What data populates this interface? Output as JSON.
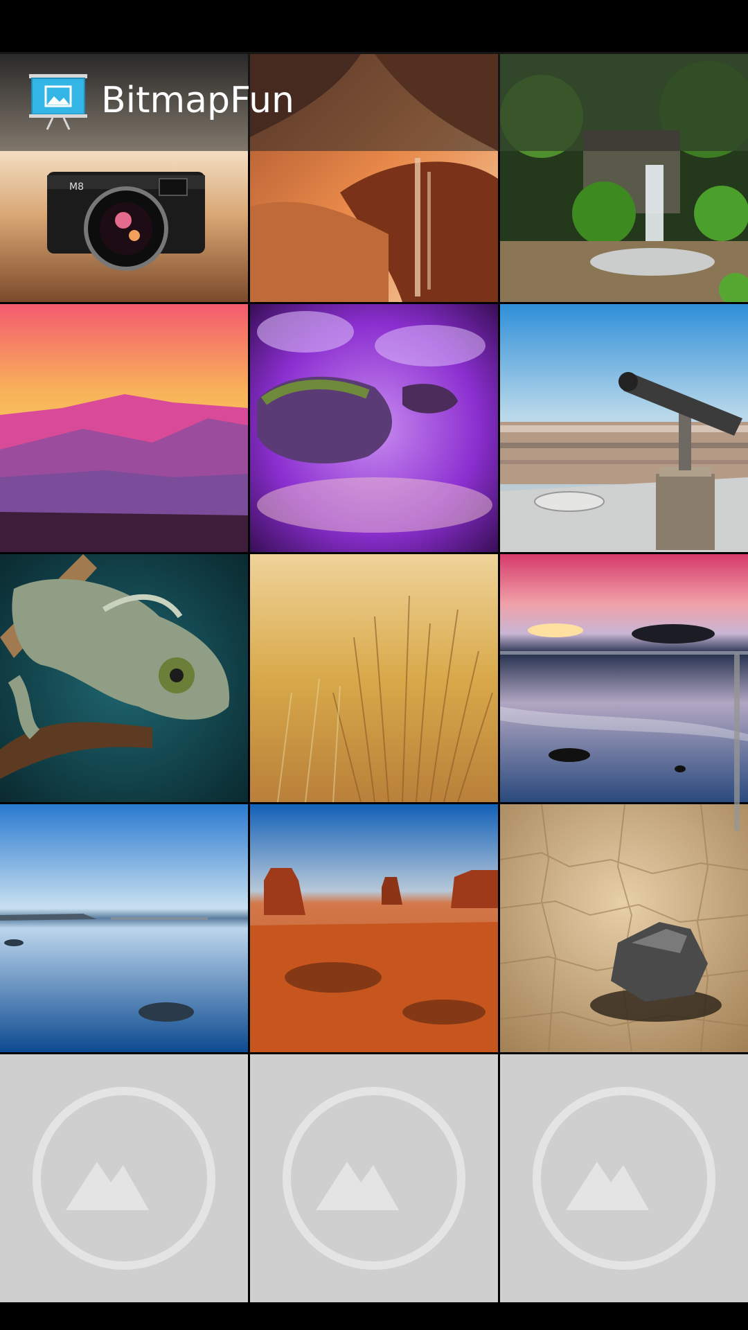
{
  "app": {
    "title": "BitmapFun",
    "icon": "slideshow-presentation-icon"
  },
  "grid": {
    "columns": 3,
    "tiles": [
      {
        "subject": "leica-camera",
        "kind": "photo"
      },
      {
        "subject": "antelope-canyon",
        "kind": "photo"
      },
      {
        "subject": "waterfall",
        "kind": "photo"
      },
      {
        "subject": "pink-mountain-sunset",
        "kind": "photo"
      },
      {
        "subject": "purple-stream-rocks",
        "kind": "photo"
      },
      {
        "subject": "city-telescope",
        "kind": "photo"
      },
      {
        "subject": "chameleon",
        "kind": "photo"
      },
      {
        "subject": "golden-grass",
        "kind": "photo"
      },
      {
        "subject": "beach-sunset",
        "kind": "photo"
      },
      {
        "subject": "blue-lake",
        "kind": "photo"
      },
      {
        "subject": "monument-valley",
        "kind": "photo"
      },
      {
        "subject": "cracked-desert-rock",
        "kind": "photo"
      },
      {
        "subject": "empty-photo-icon",
        "kind": "placeholder"
      },
      {
        "subject": "empty-photo-icon",
        "kind": "placeholder"
      },
      {
        "subject": "empty-photo-icon",
        "kind": "placeholder"
      }
    ]
  },
  "colors": {
    "action_bar": "#282828",
    "placeholder_bg": "#cfcfcf",
    "placeholder_icon": "#e4e4e4",
    "icon_blue": "#33b5e5"
  }
}
